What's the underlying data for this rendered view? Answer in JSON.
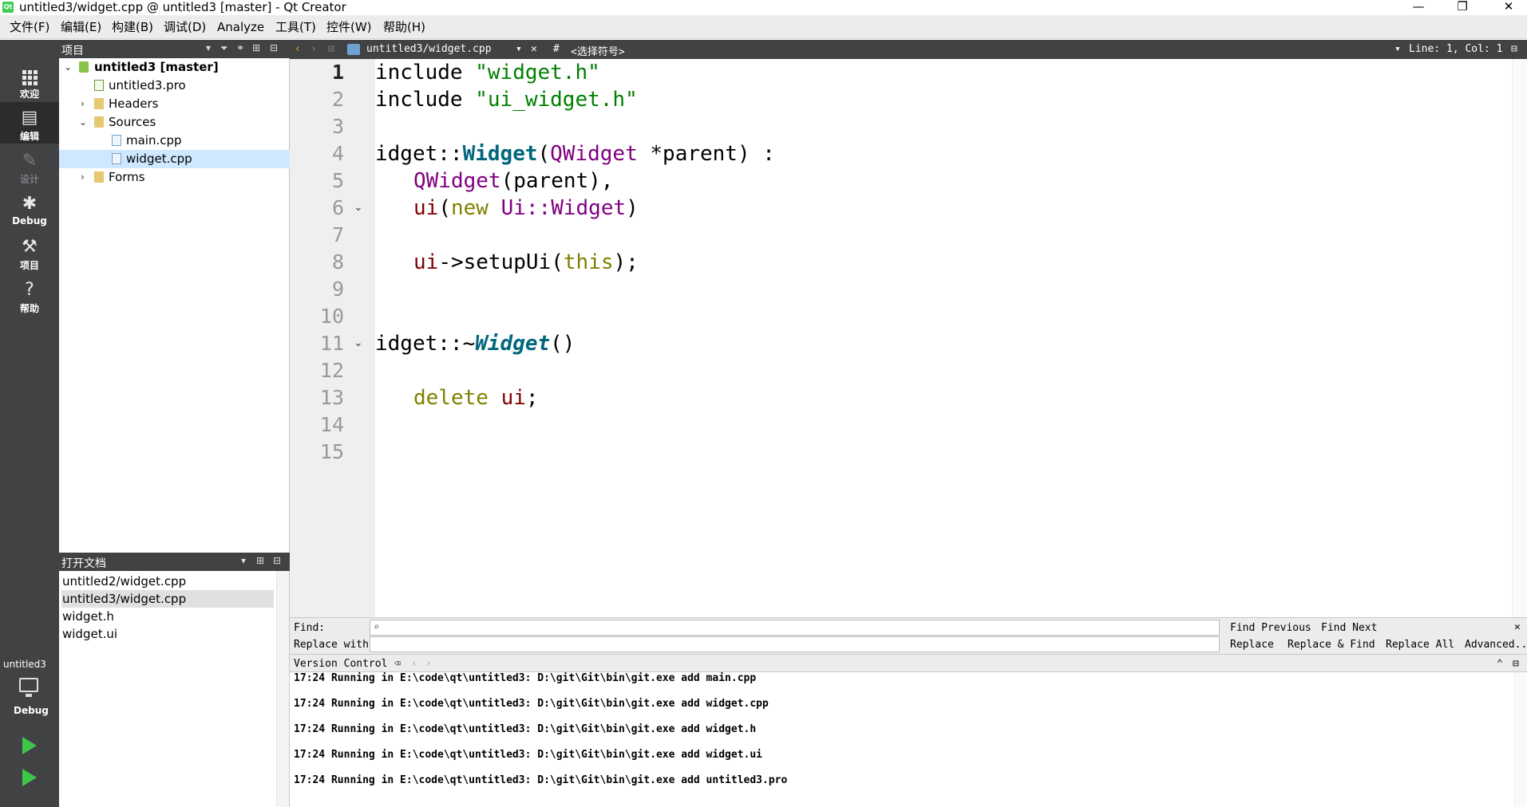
{
  "window": {
    "title": "untitled3/widget.cpp @ untitled3 [master] - Qt Creator",
    "minimize": "—",
    "maximize": "❐",
    "close": "✕"
  },
  "menu": [
    "文件(F)",
    "编辑(E)",
    "构建(B)",
    "调试(D)",
    "Analyze",
    "工具(T)",
    "控件(W)",
    "帮助(H)"
  ],
  "modes": [
    {
      "label": "欢迎",
      "icon": "grid-icon"
    },
    {
      "label": "编辑",
      "icon": "edit-icon"
    },
    {
      "label": "设计",
      "icon": "pen-icon"
    },
    {
      "label": "Debug",
      "icon": "bug-icon"
    },
    {
      "label": "项目",
      "icon": "wrench-icon"
    },
    {
      "label": "帮助",
      "icon": "help-icon"
    }
  ],
  "project_pane": {
    "title": "项目",
    "tree": [
      {
        "name": "untitled3 [master]",
        "bold": true
      },
      {
        "name": "untitled3.pro"
      },
      {
        "name": "Headers"
      },
      {
        "name": "Sources"
      },
      {
        "name": "main.cpp"
      },
      {
        "name": "widget.cpp",
        "selected": true
      },
      {
        "name": "Forms"
      }
    ]
  },
  "open_docs": {
    "title": "打开文档",
    "items": [
      "untitled2/widget.cpp",
      "untitled3/widget.cpp",
      "widget.h",
      "widget.ui"
    ],
    "selected_index": 1
  },
  "kit": {
    "project": "untitled3",
    "mode": "Debug"
  },
  "editor_toolbar": {
    "file": "untitled3/widget.cpp",
    "hash": "#",
    "symbol": "<选择符号>",
    "position": "Line: 1, Col: 1"
  },
  "editor": {
    "line_numbers": [
      "1",
      "2",
      "3",
      "4",
      "5",
      "6",
      "7",
      "8",
      "9",
      "10",
      "11",
      "12",
      "13",
      "14",
      "15"
    ],
    "current_line": "1",
    "code": {
      "l1_kw": "include ",
      "l1_str": "\"widget.h\"",
      "l2_kw": "include ",
      "l2_str": "\"ui_widget.h\"",
      "l4_a": "idget::",
      "l4_fn": "Widget",
      "l4_b": "(",
      "l4_type": "QWidget",
      "l4_c": " *parent) :",
      "l5_type": "QWidget",
      "l5_rest": "(parent),",
      "l6_mem": "ui",
      "l6_a": "(",
      "l6_kw": "new",
      "l6_b": " ",
      "l6_type": "Ui::Widget",
      "l6_c": ")",
      "l8_mem": "ui",
      "l8_a": "->setupUi(",
      "l8_kw": "this",
      "l8_b": ");",
      "l11_a": "idget::~",
      "l11_fn": "Widget",
      "l11_b": "()",
      "l13_kw": "delete",
      "l13_b": " ",
      "l13_mem": "ui",
      "l13_c": ";"
    }
  },
  "find_bar": {
    "find_label": "Find:",
    "replace_label": "Replace with:",
    "find_previous": "Find Previous",
    "find_next": "Find Next",
    "replace": "Replace",
    "replace_find": "Replace & Find",
    "replace_all": "Replace All",
    "advanced": "Advanced..."
  },
  "version_control": {
    "title": "Version Control",
    "lines": [
      "17:24 Running in E:\\code\\qt\\untitled3: D:\\git\\Git\\bin\\git.exe add main.cpp",
      "17:24 Running in E:\\code\\qt\\untitled3: D:\\git\\Git\\bin\\git.exe add widget.cpp",
      "17:24 Running in E:\\code\\qt\\untitled3: D:\\git\\Git\\bin\\git.exe add widget.h",
      "17:24 Running in E:\\code\\qt\\untitled3: D:\\git\\Git\\bin\\git.exe add widget.ui",
      "17:24 Running in E:\\code\\qt\\untitled3: D:\\git\\Git\\bin\\git.exe add untitled3.pro"
    ]
  }
}
